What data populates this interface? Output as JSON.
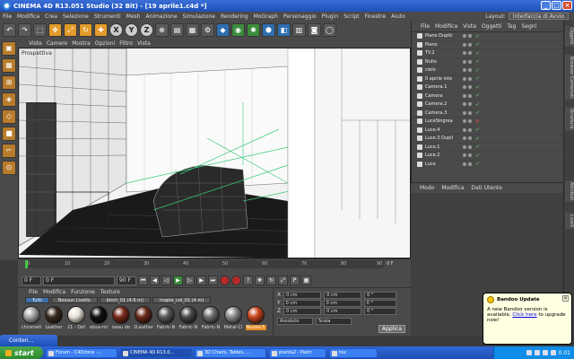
{
  "title": "CINEMA 4D R13.051 Studio (32 Bit) - [19 aprile1.c4d *]",
  "menubar": [
    "File",
    "Modifica",
    "Crea",
    "Selezione",
    "Strumenti",
    "Mesh",
    "Animazione",
    "Simulazione",
    "Rendering",
    "MoGraph",
    "Personaggio",
    "Plugin",
    "Script",
    "Finestre",
    "Aiuto"
  ],
  "layout": {
    "label": "Layout:",
    "value": "Interfaccia di Avvio"
  },
  "toolbar": {
    "x": "X",
    "y": "Y",
    "z": "Z"
  },
  "viewport": {
    "menu": [
      "Viste",
      "Camere",
      "Mostra",
      "Opzioni",
      "Filtro",
      "Vista"
    ],
    "label": "Prospettiva"
  },
  "timeline": {
    "ticks": [
      "0",
      "10",
      "20",
      "30",
      "40",
      "50",
      "60",
      "70",
      "80",
      "90"
    ],
    "end_label": "0 F",
    "start_field": "0 F",
    "end_field": "90 F"
  },
  "objects": {
    "menu": [
      "File",
      "Modifica",
      "Vista",
      "Oggetti",
      "Tag",
      "Segnl"
    ],
    "items": [
      {
        "name": "Piano Duplic",
        "check": "ok"
      },
      {
        "name": "Piano",
        "check": "ok"
      },
      {
        "name": "TV.2",
        "check": "ok"
      },
      {
        "name": "Nullo",
        "check": "ok"
      },
      {
        "name": "cielo",
        "check": "ok"
      },
      {
        "name": "0 aprile inte",
        "check": "ok"
      },
      {
        "name": "Camera.1",
        "check": "ok"
      },
      {
        "name": "Camera",
        "check": "ok"
      },
      {
        "name": "Camera.2",
        "check": "ok"
      },
      {
        "name": "Camera.3",
        "check": "ok"
      },
      {
        "name": "LuceSingrea",
        "check": "x"
      },
      {
        "name": "Luce.4",
        "check": "ok"
      },
      {
        "name": "Luce.3 Dupli",
        "check": "ok"
      },
      {
        "name": "Luce.1",
        "check": "ok"
      },
      {
        "name": "Luce.2",
        "check": "ok"
      },
      {
        "name": "Luce",
        "check": "ok"
      }
    ]
  },
  "attributes": {
    "menu": [
      "Modo",
      "Modifica",
      "Dati Utente"
    ]
  },
  "right_tabs": [
    "Oggetti",
    "Browser Contenuti",
    "Struttura",
    "Attributi",
    "Livelli"
  ],
  "materials": {
    "menu": [
      "File",
      "Modifica",
      "Funzione",
      "Texture"
    ],
    "tabs": [
      "Tutti",
      "Nessun Livello",
      "birch_01 (4.6 m)",
      "maple_col_01 (4 m)"
    ],
    "items": [
      {
        "name": "chrome0",
        "color": "#a8a8a8"
      },
      {
        "name": "Leather",
        "color": "#3a2c22"
      },
      {
        "name": "21 - Def",
        "color": "#e8e2d6"
      },
      {
        "name": "ebsa-mi",
        "color": "#111111"
      },
      {
        "name": "oeau do",
        "color": "#7a2a1e"
      },
      {
        "name": "2Leather",
        "color": "#6b2a1c"
      },
      {
        "name": "Fabric-N",
        "color": "#5a5a5a"
      },
      {
        "name": "Fabric-N",
        "color": "#4a4a4a"
      },
      {
        "name": "Fabric-N",
        "color": "#6e6e6e"
      },
      {
        "name": "Metal-Cl",
        "color": "#8c8c8c"
      },
      {
        "name": "Nuovo.5",
        "color": "#c8461e",
        "highlight": true
      }
    ]
  },
  "attr_fields": {
    "labels": [
      "X",
      "Y",
      "Z"
    ],
    "values": [
      "0 cm",
      "0 cm",
      "0 cm"
    ],
    "size_values": [
      "0 cm",
      "0 cm",
      "0 cm"
    ],
    "rot_values": [
      "0 °",
      "0 °",
      "0 °"
    ],
    "mode1": "Assoluto",
    "mode2": "Scala",
    "apply": "Applica"
  },
  "content_window": "Conten...",
  "taskbar": {
    "start": "start",
    "tasks": [
      {
        "label": "Forum - C4Dzone -..."
      },
      {
        "label": "CINEMA 4D R13.0...",
        "active": true
      },
      {
        "label": "3D Chairs, Tables, ..."
      },
      {
        "label": "pianta2 - Paint"
      },
      {
        "label": "tex"
      }
    ],
    "clock": "0.01"
  },
  "balloon": {
    "title": "Bandoo Update",
    "text1": "A new Bandoo version is available. ",
    "link": "Click here",
    "text2": " to upgrade now!"
  }
}
